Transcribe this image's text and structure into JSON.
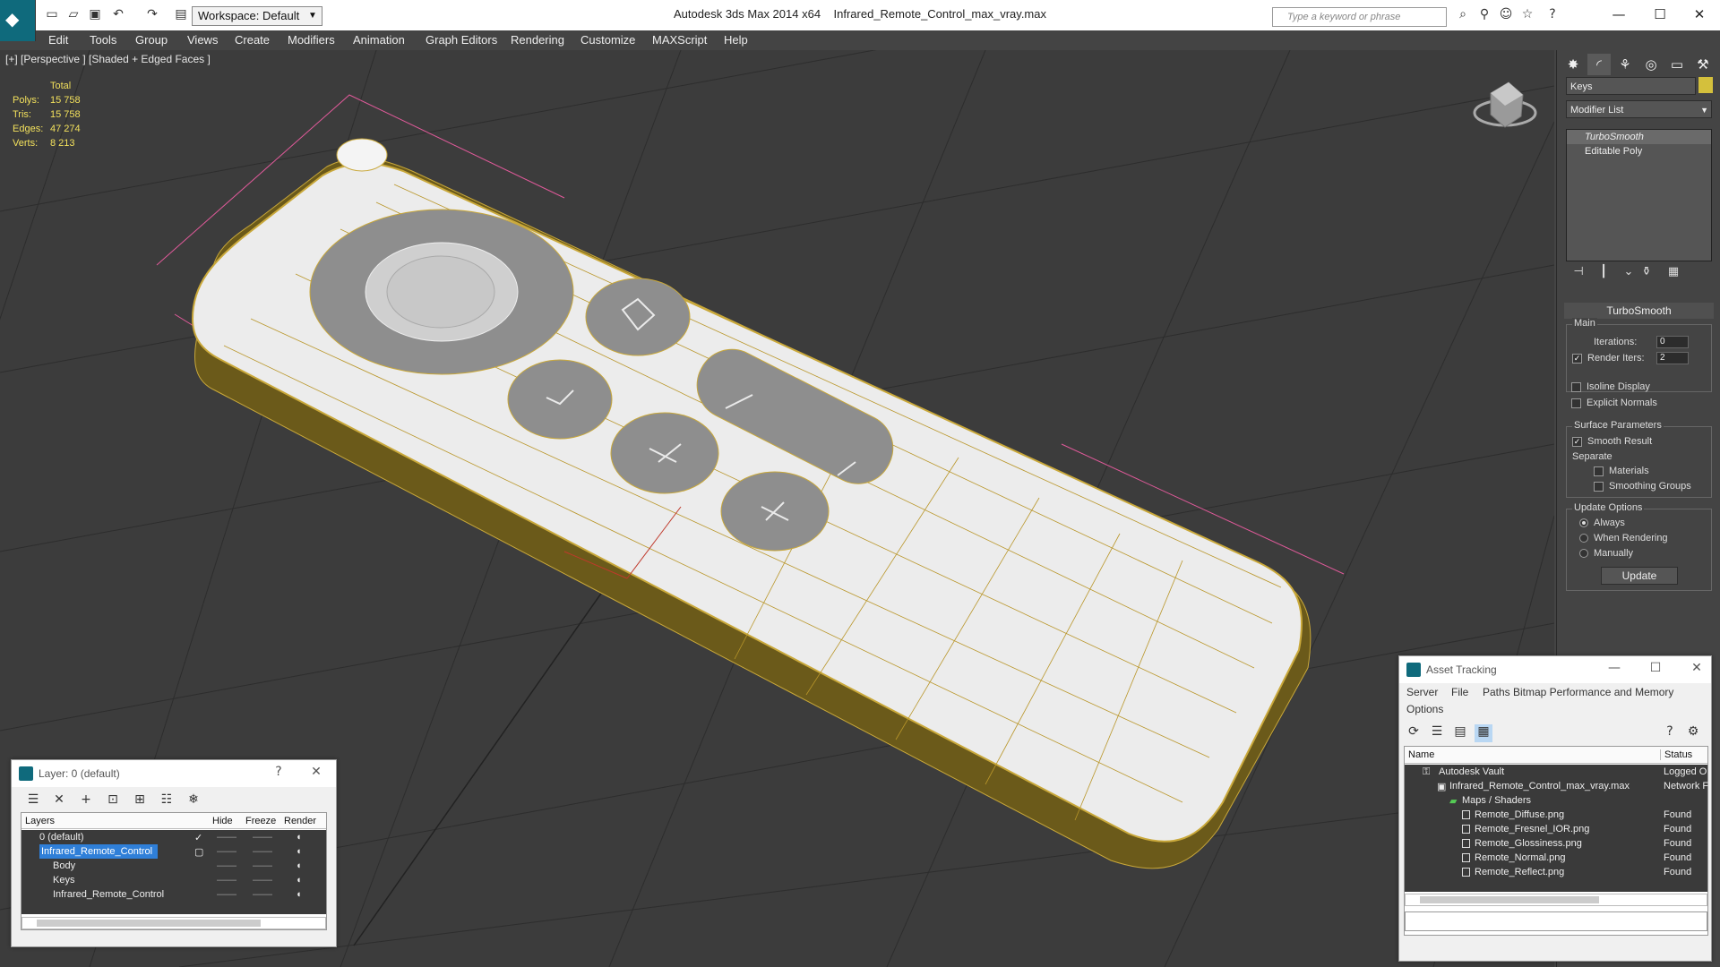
{
  "app": {
    "title": "Autodesk 3ds Max  2014 x64",
    "file": "Infrared_Remote_Control_max_vray.max",
    "workspace": "Workspace: Default",
    "search_placeholder": "Type a keyword or phrase"
  },
  "menu": [
    "Edit",
    "Tools",
    "Group",
    "Views",
    "Create",
    "Modifiers",
    "Animation",
    "Graph Editors",
    "Rendering",
    "Customize",
    "MAXScript",
    "Help"
  ],
  "viewport": {
    "label": "[+] [Perspective ] [Shaded + Edged Faces ]",
    "stats": {
      "header": "Total",
      "rows": [
        {
          "label": "Polys:",
          "value": "15 758"
        },
        {
          "label": "Tris:",
          "value": "15 758"
        },
        {
          "label": "Edges:",
          "value": "47 274"
        },
        {
          "label": "Verts:",
          "value": "8 213"
        }
      ]
    }
  },
  "command_panel": {
    "object_name": "Keys",
    "modifier_list": "Modifier List",
    "stack": [
      "TurboSmooth",
      "Editable Poly"
    ],
    "rollout_title": "TurboSmooth",
    "main_group": "Main",
    "iterations_label": "Iterations:",
    "iterations_value": "0",
    "render_iters_label": "Render Iters:",
    "render_iters_value": "2",
    "isoline": "Isoline Display",
    "explicit_normals": "Explicit Normals",
    "surface_group": "Surface Parameters",
    "smooth_result": "Smooth Result",
    "separate": "Separate",
    "materials": "Materials",
    "smoothing_groups": "Smoothing Groups",
    "update_group": "Update Options",
    "always": "Always",
    "when_rendering": "When Rendering",
    "manually": "Manually",
    "update_button": "Update"
  },
  "layer_window": {
    "title": "Layer: 0 (default)",
    "help": "?",
    "close": "✕",
    "columns": [
      "Layers",
      "Hide",
      "Freeze",
      "Render"
    ],
    "rows": [
      {
        "name": "0 (default)"
      },
      {
        "name": "Infrared_Remote_Control"
      },
      {
        "name": "Body"
      },
      {
        "name": "Keys"
      },
      {
        "name": "Infrared_Remote_Control"
      }
    ],
    "dash": "——"
  },
  "asset_window": {
    "title": "Asset Tracking",
    "menu": [
      "Server",
      "File",
      "Paths",
      "Bitmap Performance and Memory"
    ],
    "options": "Options",
    "columns": [
      "Name",
      "Status"
    ],
    "rows": [
      {
        "name": "Autodesk Vault",
        "status": "Logged O"
      },
      {
        "name": "Infrared_Remote_Control_max_vray.max",
        "status": "Network F"
      },
      {
        "name": "Maps / Shaders",
        "status": ""
      },
      {
        "name": "Remote_Diffuse.png",
        "status": "Found"
      },
      {
        "name": "Remote_Fresnel_IOR.png",
        "status": "Found"
      },
      {
        "name": "Remote_Glossiness.png",
        "status": "Found"
      },
      {
        "name": "Remote_Normal.png",
        "status": "Found"
      },
      {
        "name": "Remote_Reflect.png",
        "status": "Found"
      }
    ]
  }
}
